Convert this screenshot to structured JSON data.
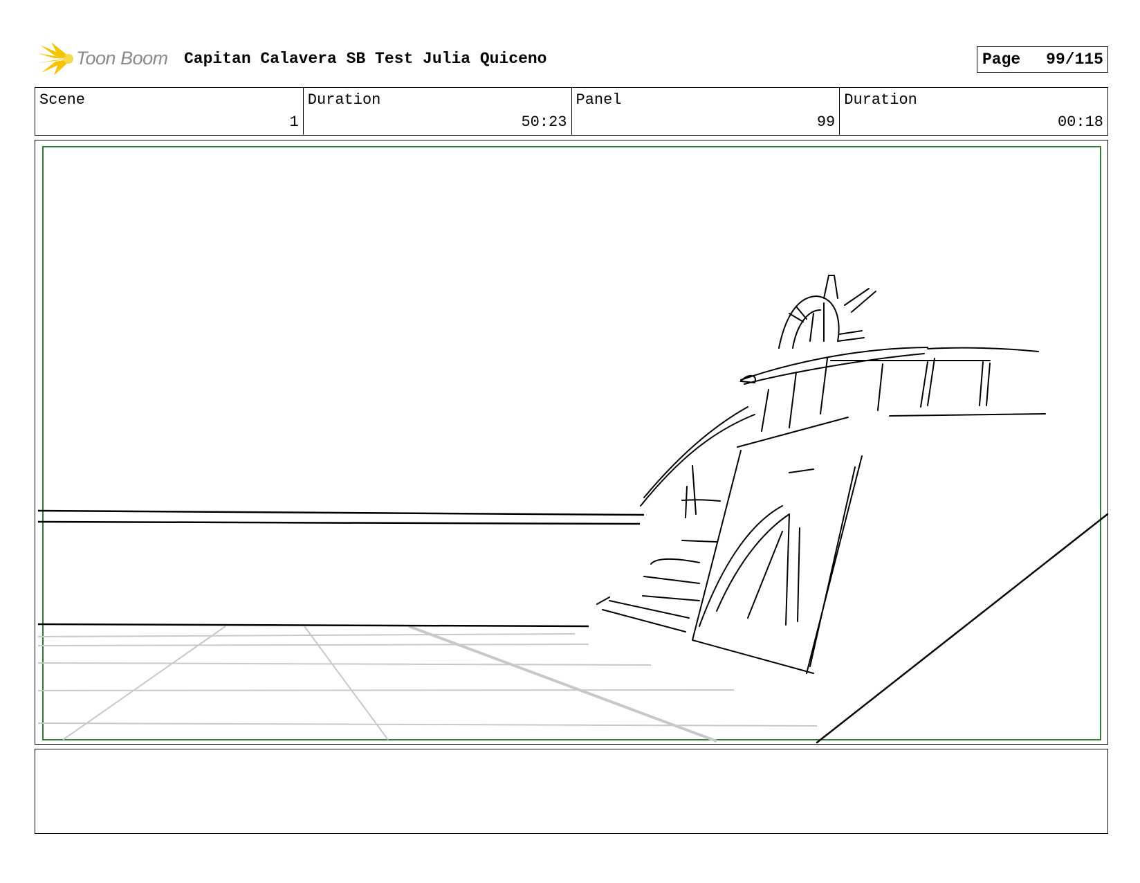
{
  "header": {
    "logo_text": "Toon Boom",
    "title": "Capitan Calavera SB Test  Julia Quiceno",
    "page_label": "Page",
    "page_value": "99/115"
  },
  "info": {
    "scene_label": "Scene",
    "scene_value": "1",
    "scene_duration_label": "Duration",
    "scene_duration_value": "50:23",
    "panel_label": "Panel",
    "panel_value": "99",
    "panel_duration_label": "Duration",
    "panel_duration_value": "00:18"
  },
  "notes": {
    "text": ""
  },
  "colors": {
    "safe_frame": "#2e7d32",
    "logo_yellow": "#f5c400",
    "logo_text": "#8a8a8a",
    "guide_lines": "#c8c8c8"
  },
  "icons": {
    "logo": "toon-boom-sunburst-icon"
  }
}
